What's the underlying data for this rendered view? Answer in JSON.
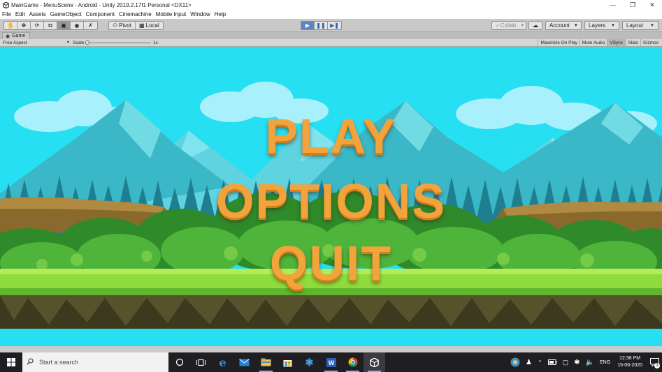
{
  "window": {
    "title": "MainGame - MenuScene - Android - Unity 2019.2.17f1 Personal <DX11>",
    "minimize_icon": "minimize-icon",
    "maximize_icon": "restore-icon",
    "close_icon": "close-icon"
  },
  "menubar": {
    "items": [
      "File",
      "Edit",
      "Assets",
      "GameObject",
      "Component",
      "Cinemachine",
      "Mobile Input",
      "Window",
      "Help"
    ]
  },
  "toolbar": {
    "tools": [
      "hand-tool-icon",
      "move-tool-icon",
      "rotate-tool-icon",
      "scale-tool-icon",
      "rect-tool-icon",
      "transform-tool-icon",
      "custom-tool-icon"
    ],
    "pivot_label": "Pivot",
    "local_label": "Local",
    "play_controls": [
      "play-icon",
      "pause-icon",
      "step-icon"
    ],
    "collab_label": "Collab",
    "account_label": "Account",
    "layers_label": "Layers",
    "layout_label": "Layout"
  },
  "game_tab": {
    "label": "Game"
  },
  "game_controls": {
    "aspect": "Free Aspect",
    "scale_label": "Scale",
    "scale_value": "1x",
    "toggles": [
      {
        "label": "Maximize On Play",
        "on": false
      },
      {
        "label": "Mute Audio",
        "on": false
      },
      {
        "label": "VSync",
        "on": true
      },
      {
        "label": "Stats",
        "on": false
      },
      {
        "label": "Gizmos",
        "on": false
      }
    ]
  },
  "game_menu": {
    "play": "PLAY",
    "options": "OPTIONS",
    "quit": "QUIT",
    "text_color": "#f3a33b"
  },
  "taskbar": {
    "search_placeholder": "Start a search",
    "apps": [
      "task-view-icon",
      "edge-icon",
      "mail-icon",
      "file-explorer-icon",
      "store-icon",
      "visual-studio-icon",
      "word-icon",
      "chrome-icon",
      "unity-icon"
    ],
    "language": "ENG",
    "time": "12:36 PM",
    "date": "15-06-2020",
    "notification_count": "3"
  }
}
